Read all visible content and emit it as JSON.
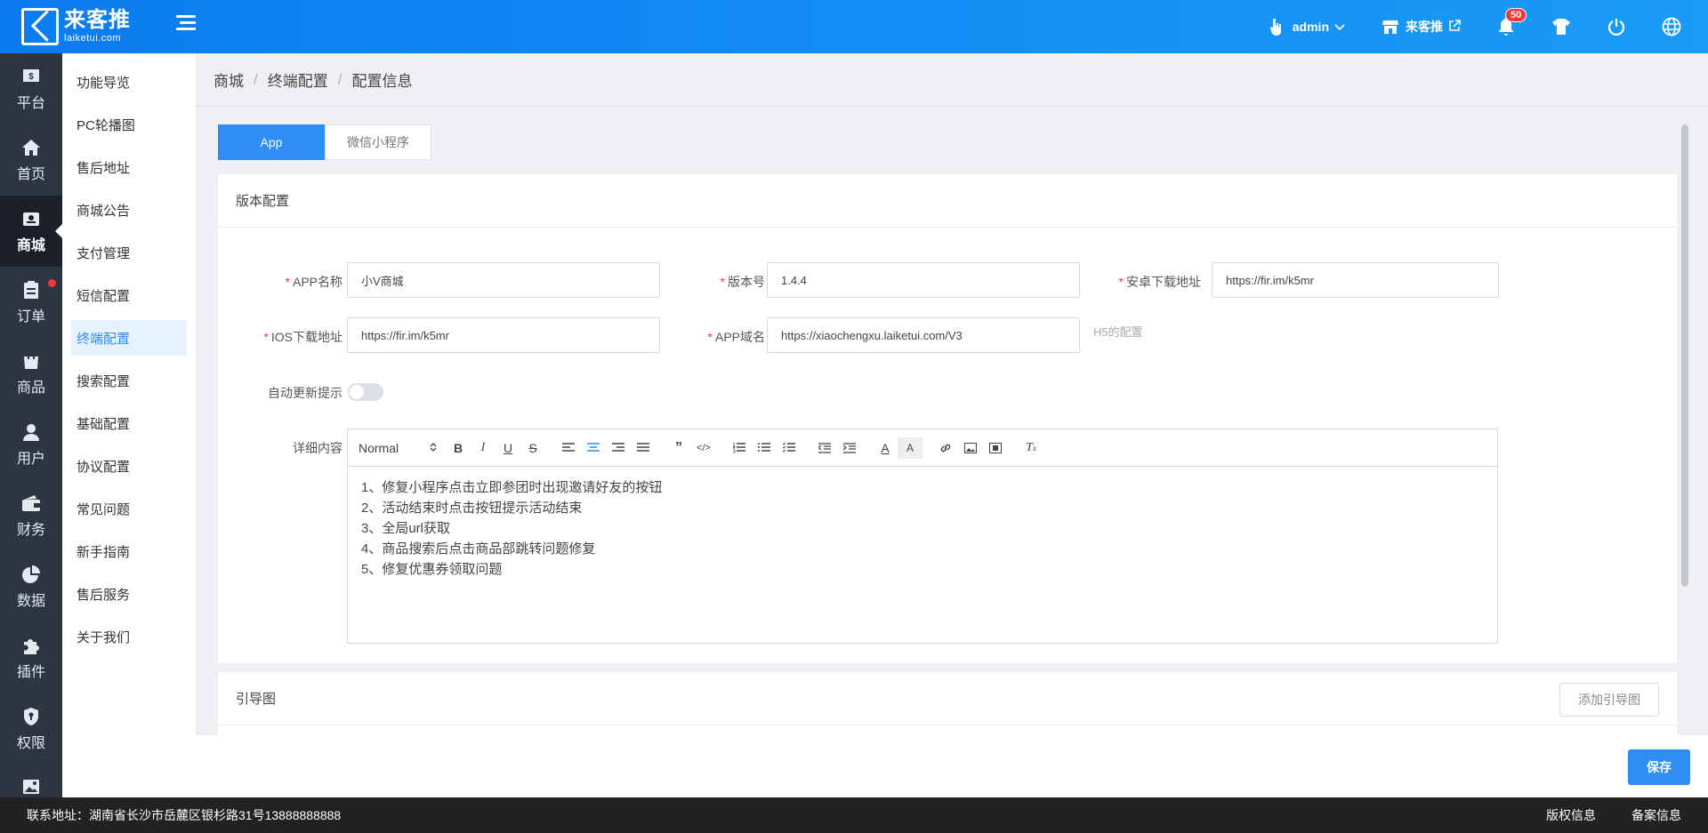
{
  "brand": {
    "name_cn": "来客推",
    "domain": "laiketui.com"
  },
  "topbar": {
    "user": "admin",
    "store": "来客推",
    "notification_count": "50"
  },
  "leftnav": [
    {
      "label": "平台",
      "icon": "platform-icon"
    },
    {
      "label": "首页",
      "icon": "home-icon"
    },
    {
      "label": "商城",
      "icon": "mall-icon",
      "active": true
    },
    {
      "label": "订单",
      "icon": "order-icon",
      "dot": true
    },
    {
      "label": "商品",
      "icon": "goods-icon"
    },
    {
      "label": "用户",
      "icon": "user-icon"
    },
    {
      "label": "财务",
      "icon": "wallet-icon"
    },
    {
      "label": "数据",
      "icon": "chart-icon"
    },
    {
      "label": "插件",
      "icon": "plugin-icon"
    },
    {
      "label": "权限",
      "icon": "shield-icon"
    }
  ],
  "submenu": [
    "功能导览",
    "PC轮播图",
    "售后地址",
    "商城公告",
    "支付管理",
    "短信配置",
    "终端配置",
    "搜索配置",
    "基础配置",
    "协议配置",
    "常见问题",
    "新手指南",
    "售后服务",
    "关于我们"
  ],
  "breadcrumb": [
    "商城",
    "终端配置",
    "配置信息"
  ],
  "tabs": [
    "App",
    "微信小程序"
  ],
  "version_card": {
    "title": "版本配置",
    "app_name_label": "APP名称",
    "app_name_value": "小V商城",
    "version_label": "版本号",
    "version_value": "1.4.4",
    "android_label": "安卓下载地址",
    "android_value": "https://fir.im/k5mr",
    "ios_label": "IOS下载地址",
    "ios_value": "https://fir.im/k5mr",
    "domain_label": "APP域名",
    "domain_value": "https://xiaochengxu.laiketui.com/V3",
    "domain_hint": "H5的配置",
    "auto_update_label": "自动更新提示",
    "detail_label": "详细内容",
    "editor_format": "Normal",
    "editor_lines": [
      "1、修复小程序点击立即参团时出现邀请好友的按钮",
      "2、活动结束时点击按钮提示活动结束",
      "3、全局url获取",
      "4、商品搜索后点击商品部跳转问题修复",
      "5、修复优惠券领取问题"
    ]
  },
  "guide_card": {
    "title": "引导图",
    "add_button": "添加引导图"
  },
  "save_button": "保存",
  "footer": {
    "address": "联系地址：湖南省长沙市岳麓区银杉路31号13888888888",
    "copyright": "版权信息",
    "record": "备案信息"
  },
  "colors": {
    "primary": "#2e8ef5",
    "topbar": "#1a9bf5",
    "nav": "#2d3442",
    "danger": "#f23838"
  }
}
